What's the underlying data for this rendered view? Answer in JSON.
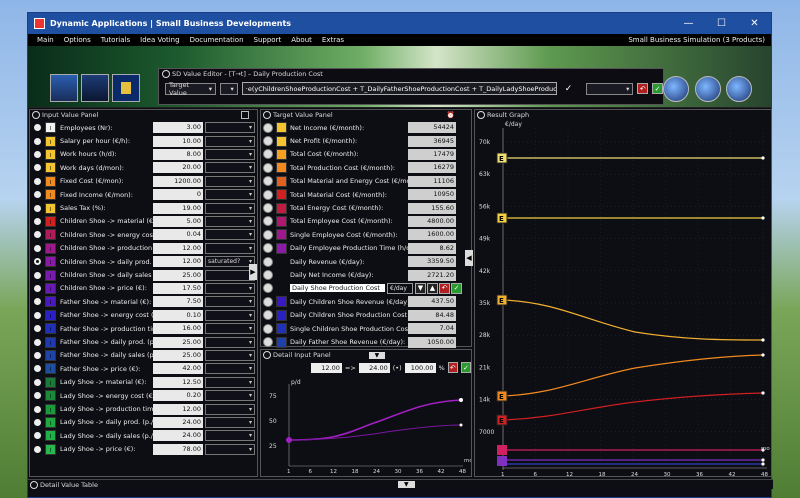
{
  "window": {
    "title": "Dynamic Applications | Small Business Developments",
    "controls": {
      "minimize": "—",
      "maximize": "☐",
      "close": "✕"
    }
  },
  "menu": {
    "items": [
      "Main",
      "Options",
      "Tutorials",
      "Idea Voting",
      "Documentation",
      "Support",
      "About",
      "Extras"
    ],
    "right_text": "Small Business Simulation  (3 Products)"
  },
  "sd_editor": {
    "title": "SD Value Editor - [T→t] – Daily Production Cost",
    "mode": "Target Value",
    "formula": "·e(yChildrenShoeProductionCost + T_DailyFatherShoeProductionCost + T_DailyLadyShoeProductionCost"
  },
  "input_panel": {
    "title": "Input Value Panel",
    "rows": [
      {
        "label": "Employees (Nr):",
        "value": "3.00",
        "color": "#f2f2f2",
        "selected": false
      },
      {
        "label": "Salary per hour (€/h):",
        "value": "10.00",
        "color": "#f4c430",
        "selected": false
      },
      {
        "label": "Work hours (h/d):",
        "value": "8.00",
        "color": "#f4c430",
        "selected": false
      },
      {
        "label": "Work days (d/mon):",
        "value": "20.00",
        "color": "#f4c430",
        "selected": false
      },
      {
        "label": "Fixed Cost (€/mon):",
        "value": "1200.00",
        "color": "#f08a20",
        "selected": false
      },
      {
        "label": "Fixed Income (€/mon):",
        "value": "0",
        "color": "#f08a20",
        "selected": false
      },
      {
        "label": "Sales Tax (%):",
        "value": "19.00",
        "color": "#f4c430",
        "selected": false
      },
      {
        "label": "Children Shoe -> material (€):",
        "value": "5.00",
        "color": "#d02020",
        "selected": false
      },
      {
        "label": "Children Shoe -> energy cost (€):",
        "value": "0.04",
        "color": "#b01c5a",
        "selected": false
      },
      {
        "label": "Children Shoe -> production time (min)",
        "value": "12.00",
        "color": "#a0188c",
        "selected": false
      },
      {
        "label": "Children Shoe -> daily prod. (p./d):",
        "value": "12.00",
        "color": "#8c1aa8",
        "selected": true,
        "dropdown": "saturated?"
      },
      {
        "label": "Children Shoe -> daily sales (p./d):",
        "value": "25.00",
        "color": "#7a1ab0",
        "selected": false
      },
      {
        "label": "Children Shoe -> price (€):",
        "value": "17.50",
        "color": "#6a1ab8",
        "selected": false
      },
      {
        "label": "Father Shoe -> material (€):",
        "value": "7.50",
        "color": "#4a1ac0",
        "selected": false
      },
      {
        "label": "Father Shoe -> energy cost (€):",
        "value": "0.10",
        "color": "#2a20c8",
        "selected": false
      },
      {
        "label": "Father Shoe -> production time (min)",
        "value": "16.00",
        "color": "#2030b8",
        "selected": false
      },
      {
        "label": "Father Shoe -> daily prod. (p./d):",
        "value": "25.00",
        "color": "#1e3ab0",
        "selected": false
      },
      {
        "label": "Father Shoe -> daily sales (p./d):",
        "value": "25.00",
        "color": "#1e44a8",
        "selected": false
      },
      {
        "label": "Father Shoe -> price (€):",
        "value": "42.00",
        "color": "#1e4ea0",
        "selected": false
      },
      {
        "label": "Lady Shoe -> material (€):",
        "value": "12.50",
        "color": "#1a7a3a",
        "selected": false
      },
      {
        "label": "Lady Shoe -> energy cost (€):",
        "value": "0.20",
        "color": "#1a8a3a",
        "selected": false
      },
      {
        "label": "Lady Shoe -> production time (min/p)",
        "value": "12.00",
        "color": "#1a9a3a",
        "selected": false
      },
      {
        "label": "Lady Shoe -> daily prod. (p./d):",
        "value": "24.00",
        "color": "#20a840",
        "selected": false
      },
      {
        "label": "Lady Shoe -> daily sales (p./d):",
        "value": "24.00",
        "color": "#20b048",
        "selected": false
      },
      {
        "label": "Lady Shoe -> price (€):",
        "value": "78.00",
        "color": "#28b850",
        "selected": false
      }
    ]
  },
  "target_panel": {
    "title": "Target Value Panel",
    "rows": [
      {
        "label": "Net Income (€/month):",
        "value": "54424",
        "color": "#f4c430"
      },
      {
        "label": "Net Profit (€/month):",
        "value": "36945",
        "color": "#f4c430"
      },
      {
        "label": "Total Cost (€/month):",
        "value": "17479",
        "color": "#f4a020"
      },
      {
        "label": "Total Production Cost (€/month):",
        "value": "16279",
        "color": "#f08a20"
      },
      {
        "label": "Total Material and Energy Cost (€/month):",
        "value": "11106",
        "color": "#e06020"
      },
      {
        "label": "Total Material Cost (€/month):",
        "value": "10950",
        "color": "#d02020"
      },
      {
        "label": "Total Energy Cost (€/month):",
        "value": "155.60",
        "color": "#c01c40"
      },
      {
        "label": "Total Employee Cost (€/month):",
        "value": "4800.00",
        "color": "#b01870"
      },
      {
        "label": "Single Employee Cost (€/month):",
        "value": "1600.00",
        "color": "#a01890"
      },
      {
        "label": "Daily Employee Production Time (h/day):",
        "value": "8.62",
        "color": "#8c1aa8"
      },
      {
        "label": "Daily Revenue (€/day):",
        "value": "3359.50",
        "color": ""
      },
      {
        "label": "Daily Net Income (€/day):",
        "value": "2721.20",
        "color": ""
      },
      {
        "label": "Daily Shoe Production Cost",
        "value": "",
        "color": "",
        "editing": true
      },
      {
        "label": "Daily Children Shoe Revenue (€/day):",
        "value": "437.50",
        "color": "#3a1ac0"
      },
      {
        "label": "Daily Children Shoe Production Cost (€/day):",
        "value": "84.48",
        "color": "#2a22c0"
      },
      {
        "label": "Single Children Shoe Production Cost (€/p):",
        "value": "7.04",
        "color": "#2030b8"
      },
      {
        "label": "Daily Father Shoe Revenue (€/day):",
        "value": "1050.00",
        "color": "#1e40a8"
      }
    ],
    "editing_unit": "€/day"
  },
  "detail_input": {
    "title": "Detail Input Panel",
    "from": "12.00",
    "arrow": "=>",
    "to": "24.00",
    "percent": "100.00",
    "percent_unit": "%",
    "y_unit": "p/d",
    "x_unit": "mo",
    "y_ticks": [
      "75",
      "50",
      "25"
    ],
    "x_ticks": [
      "1",
      "6",
      "12",
      "18",
      "24",
      "30",
      "36",
      "42",
      "48"
    ]
  },
  "result_graph": {
    "title": "Result Graph",
    "y_unit": "€/day",
    "x_unit": "mo",
    "y_ticks": [
      "70k",
      "63k",
      "56k",
      "49k",
      "42k",
      "35k",
      "28k",
      "21k",
      "14k",
      "7000"
    ],
    "x_ticks": [
      "1",
      "6",
      "12",
      "18",
      "24",
      "30",
      "36",
      "42",
      "48"
    ],
    "markers": [
      "E",
      "E",
      "E",
      "E",
      "E"
    ]
  },
  "footer": {
    "title": "Detail Value Table"
  }
}
